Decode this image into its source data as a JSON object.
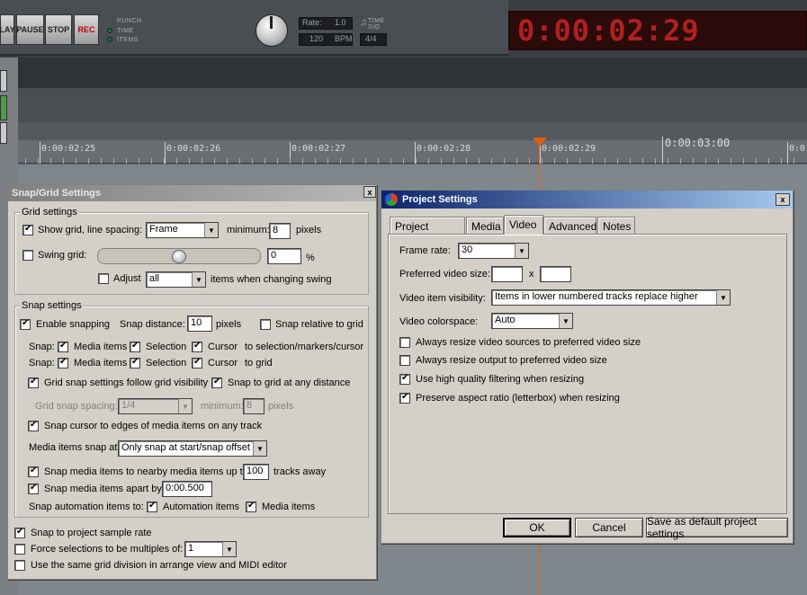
{
  "transport": {
    "buttons": [
      "LAY",
      "PAUSE",
      "STOP",
      "REC"
    ],
    "options": [
      "PUNCH",
      "TIME",
      "ITEMS"
    ],
    "rate_label": "Rate:",
    "rate_value": "1.0",
    "bpm_value": "120",
    "bpm_label": "BPM",
    "timesig_label_1": "TIME",
    "timesig_label_2": "SIG",
    "timesig_value": "4/4",
    "clock": "0:00:02:29",
    "colors": {
      "clock": "#b02020",
      "rec": "#c00000"
    }
  },
  "ruler": {
    "labels": [
      "0:00:02:25",
      "0:00:02:26",
      "0:00:02:27",
      "0:00:02:28",
      "0:00:02:29",
      "0:00:03:00",
      "0:0"
    ],
    "cursor_color": "#e06010"
  },
  "snap_dialog": {
    "title": "Snap/Grid Settings",
    "close": "x",
    "grid_group": "Grid settings",
    "show_grid": "Show grid, line spacing:",
    "line_spacing": "Frame",
    "minimum_label": "minimum:",
    "minimum_value": "8",
    "pixels": "pixels",
    "swing_grid": "Swing grid:",
    "swing_value": "0",
    "percent": "%",
    "adjust": "Adjust",
    "adjust_value": "all",
    "adjust_suffix": "items when changing swing",
    "snap_group": "Snap settings",
    "enable_snapping": "Enable snapping",
    "snap_distance_label": "Snap distance:",
    "snap_distance_value": "10",
    "snap_distance_units": "pixels",
    "snap_relative": "Snap relative to grid",
    "snap_row_label": "Snap:",
    "media_items": "Media items",
    "selection": "Selection",
    "cursor": "Cursor",
    "to_markers": "to selection/markers/cursor",
    "to_grid": "to grid",
    "follow_visibility": "Grid snap settings follow grid visibility",
    "snap_any_distance": "Snap to grid at any distance",
    "grid_snap_spacing": "Grid snap spacing:",
    "grid_snap_value": "1/4",
    "grid_snap_minimum": "minimum:",
    "grid_snap_min_value": "8",
    "grid_snap_pixels": "pixels",
    "snap_cursor_edges": "Snap cursor to edges of media items on any track",
    "media_snap_at": "Media items snap at:",
    "media_snap_value": "Only snap at start/snap offset",
    "snap_nearby": "Snap media items to nearby media items up to:",
    "nearby_value": "100",
    "tracks_away": "tracks away",
    "snap_apart": "Snap media items apart by:",
    "apart_value": "0:00.500",
    "automation_label": "Snap automation items to:",
    "automation_items": "Automation items",
    "automation_media": "Media items",
    "sample_rate": "Snap to project sample rate",
    "force_multiples": "Force selections to be multiples of:",
    "force_value": "1",
    "same_grid": "Use the same grid division in arrange view and MIDI editor"
  },
  "project_dialog": {
    "title": "Project Settings",
    "close": "x",
    "tabs": [
      "Project Settings",
      "Media",
      "Video",
      "Advanced",
      "Notes"
    ],
    "frame_rate_label": "Frame rate:",
    "frame_rate_value": "30",
    "preferred_size_label": "Preferred video size:",
    "size_x": "x",
    "visibility_label": "Video item visibility:",
    "visibility_value": "Items in lower numbered tracks replace higher",
    "colorspace_label": "Video colorspace:",
    "colorspace_value": "Auto",
    "resize_sources": "Always resize video sources to preferred video size",
    "resize_output": "Always resize output to preferred video size",
    "high_quality": "Use high quality filtering when resizing",
    "preserve_aspect": "Preserve aspect ratio (letterbox) when resizing",
    "ok": "OK",
    "cancel": "Cancel",
    "save_default": "Save as default project settings"
  }
}
